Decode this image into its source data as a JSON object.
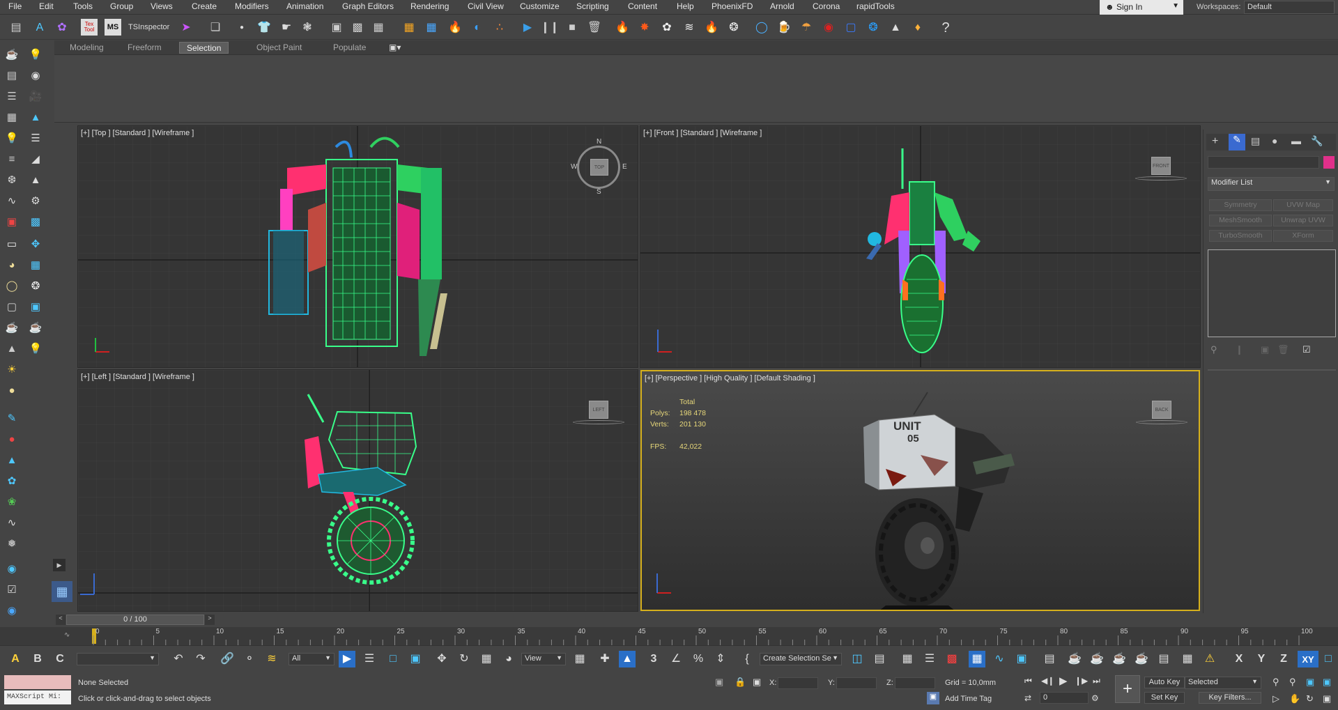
{
  "menu": [
    "File",
    "Edit",
    "Tools",
    "Group",
    "Views",
    "Create",
    "Modifiers",
    "Animation",
    "Graph Editors",
    "Rendering",
    "Civil View",
    "Customize",
    "Scripting",
    "Content",
    "Help",
    "PhoenixFD",
    "Arnold",
    "Corona",
    "rapidTools"
  ],
  "signin": {
    "label": "Sign In"
  },
  "workspaces": {
    "label": "Workspaces:",
    "value": "Default"
  },
  "toolbar": {
    "tsinspector": "TSInspector",
    "ms_badge": "MS",
    "tex_badge": "Tex Tool"
  },
  "ribbon_tabs": [
    "Modeling",
    "Freeform",
    "Selection",
    "Object Paint",
    "Populate"
  ],
  "ribbon_active": "Selection",
  "viewports": {
    "top": {
      "label": "[+] [Top ] [Standard ] [Wireframe ]",
      "compass": {
        "n": "N",
        "s": "S",
        "e": "E",
        "w": "W",
        "cube": "TOP"
      }
    },
    "front": {
      "label": "[+] [Front ] [Standard ] [Wireframe ]",
      "cube": "FRONT"
    },
    "left": {
      "label": "[+] [Left ] [Standard ] [Wireframe ]",
      "cube": "LEFT"
    },
    "perspective": {
      "label": "[+] [Perspective ] [High Quality ] [Default Shading ]",
      "cube": "BACK",
      "stats": {
        "total_label": "Total",
        "polys_label": "Polys:",
        "polys": "198 478",
        "verts_label": "Verts:",
        "verts": "201 130",
        "fps_label": "FPS:",
        "fps": "42,022"
      },
      "decal": {
        "line1": "UNIT",
        "line2": "05"
      }
    }
  },
  "command_panel": {
    "modifier_list": "Modifier List",
    "buttons": [
      "Symmetry",
      "UVW Map",
      "MeshSmooth",
      "Unwrap UVW",
      "TurboSmooth",
      "XForm"
    ]
  },
  "timeslider": {
    "frame": "0 / 100"
  },
  "timeline": {
    "ticks": [
      "0",
      "5",
      "10",
      "15",
      "20",
      "25",
      "30",
      "35",
      "40",
      "45",
      "50",
      "55",
      "60",
      "65",
      "70",
      "75",
      "80",
      "85",
      "90",
      "95",
      "100"
    ]
  },
  "bottom": {
    "filter_value": "All",
    "view_value": "View",
    "create_selection_set": "Create Selection Se",
    "status_none": "None Selected",
    "status_hint": "Click or click-and-drag to select objects",
    "maxscript": "MAXScript Mi:",
    "x_label": "X:",
    "y_label": "Y:",
    "z_label": "Z:",
    "grid": "Grid = 10,0mm",
    "add_time_tag": "Add Time Tag",
    "auto_key": "Auto Key",
    "set_key": "Set Key",
    "selected": "Selected",
    "key_filters": "Key Filters...",
    "frame_field": "0",
    "axis_x": "X",
    "axis_y": "Y",
    "axis_z": "Z",
    "axis_xy": "XY"
  },
  "colors": {
    "accent_yellow": "#d6b01c",
    "selection_blue": "#2a6fc7"
  }
}
